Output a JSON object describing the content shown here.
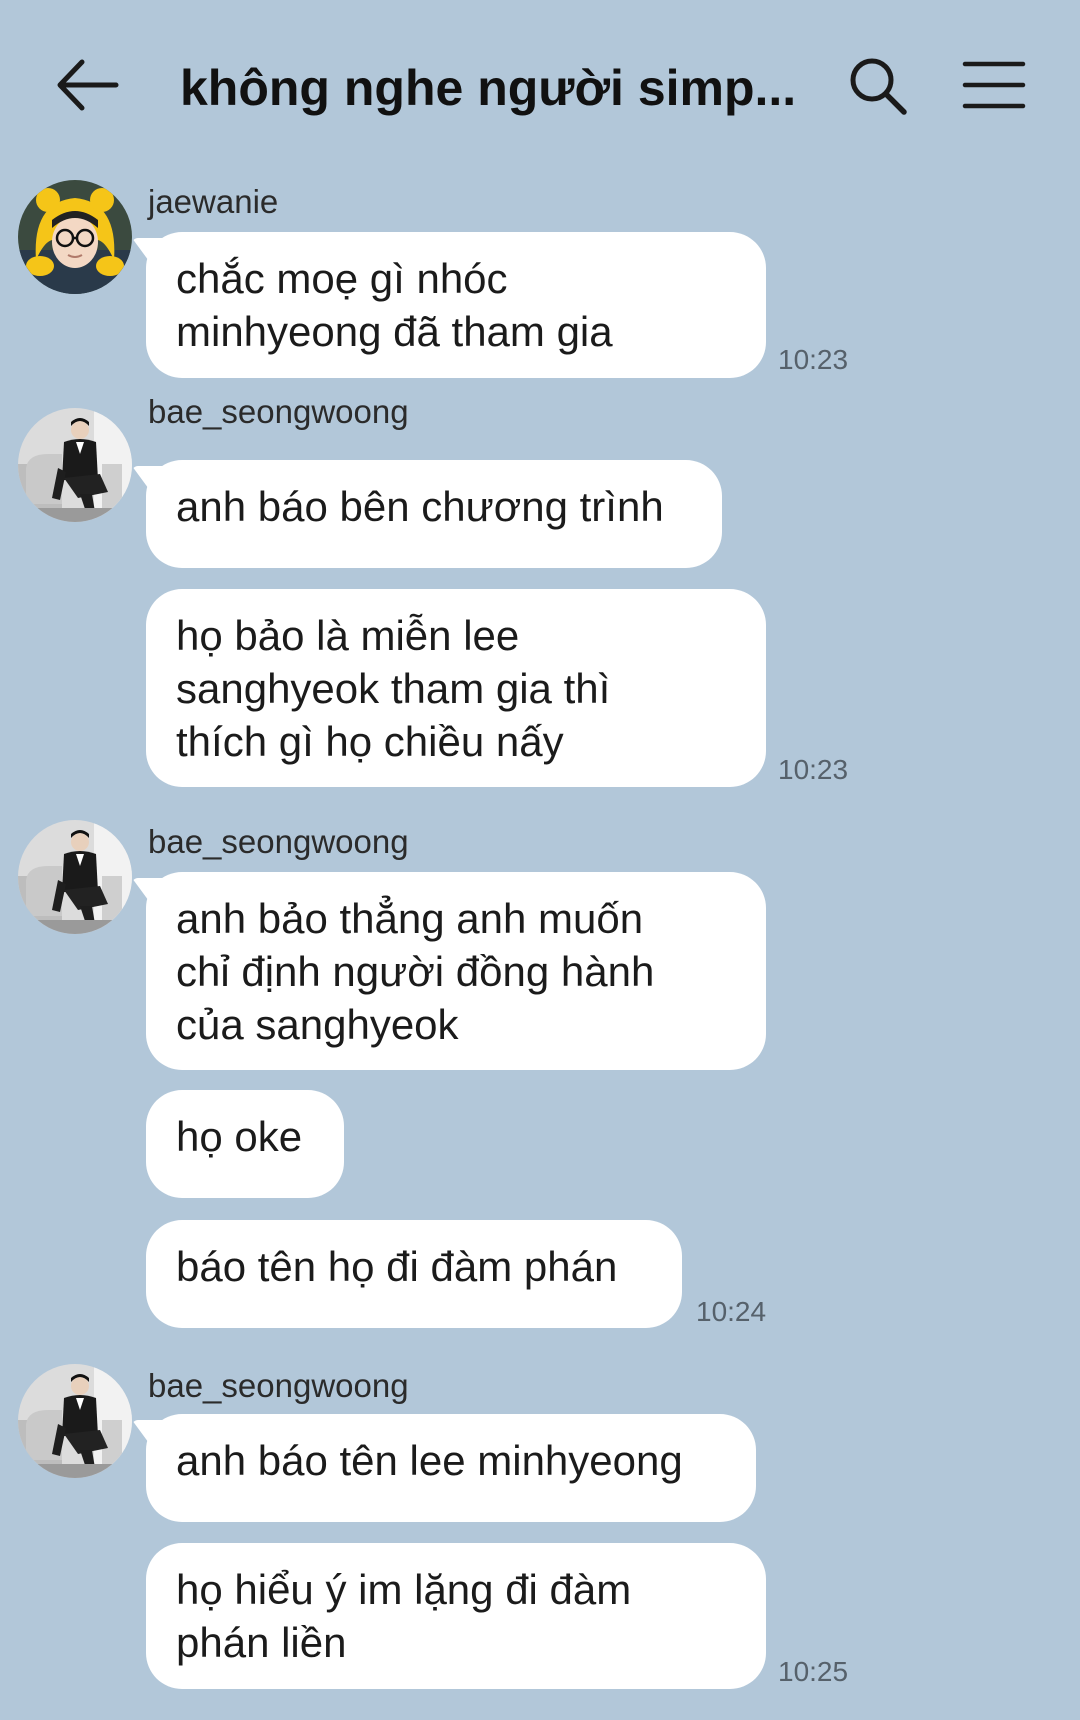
{
  "header": {
    "title": "không nghe người simp...",
    "back_icon": "arrow-left-icon",
    "search_icon": "search-icon",
    "menu_icon": "hamburger-menu-icon"
  },
  "colors": {
    "background": "#b2c7d9",
    "bubble": "#ffffff",
    "text": "#1b1b1b",
    "time": "#56616b"
  },
  "groups": [
    {
      "sender": "jaewanie",
      "messages": [
        {
          "text": "chắc moẹ gì nhóc\nminhyeong đã tham gia",
          "time": "10:23"
        }
      ]
    },
    {
      "sender": "bae_seongwoong",
      "messages": [
        {
          "text": "anh báo bên chương trình",
          "time": ""
        },
        {
          "text": "họ bảo là miễn lee\nsanghyeok tham gia thì\nthích gì họ chiều nấy",
          "time": "10:23"
        }
      ]
    },
    {
      "sender": "bae_seongwoong",
      "messages": [
        {
          "text": "anh bảo thẳng anh muốn\nchỉ định người đồng hành\ncủa sanghyeok",
          "time": ""
        },
        {
          "text": "họ oke",
          "time": ""
        },
        {
          "text": "báo tên họ đi đàm phán",
          "time": "10:24"
        }
      ]
    },
    {
      "sender": "bae_seongwoong",
      "messages": [
        {
          "text": "anh báo tên lee minhyeong",
          "time": ""
        },
        {
          "text": "họ hiểu ý im lặng đi đàm\nphán liền",
          "time": "10:25"
        }
      ]
    }
  ]
}
